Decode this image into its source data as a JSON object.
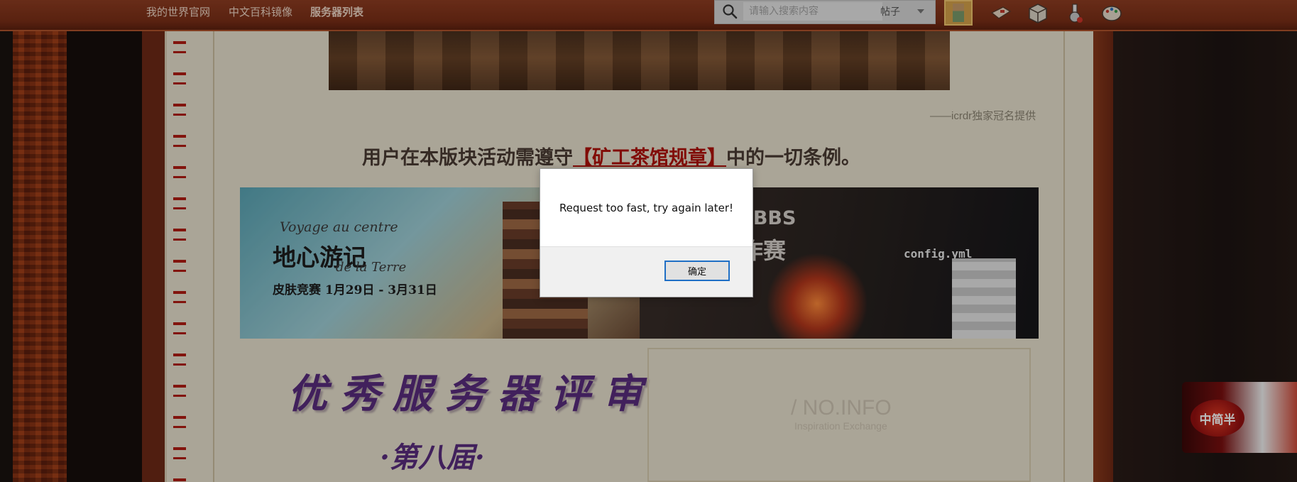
{
  "nav": {
    "links": [
      {
        "label": "我的世界官网"
      },
      {
        "label": "中文百科镜像"
      },
      {
        "label": "服务器列表"
      }
    ],
    "search_placeholder": "请输入搜索内容",
    "search_type": "帖子"
  },
  "page": {
    "credit": "——icrdr独家冠名提供",
    "rules_prefix": "用户在本版块活动需遵守",
    "rules_link": "【矿工茶馆规章】",
    "rules_suffix": "中的一切条例。",
    "banner_left": {
      "cursive_top": "Voyage au centre",
      "title": "地心游记",
      "cursive_bottom": "de la Terre",
      "subtitle": "皮肤竞赛  1月29日 - 3月31日"
    },
    "banner_right": {
      "title_top": "CBBS",
      "title_bottom": "创作赛",
      "config_label": "config.yml"
    },
    "review_title": "优秀服务器评审",
    "review_sub": "·第八届·",
    "info_brand": "/ NO.INFO",
    "info_tagline": "Inspiration Exchange",
    "mascot_label": "中简半"
  },
  "dialog": {
    "message": "Request too fast, try again later!",
    "ok_label": "确定"
  },
  "colors": {
    "topbar": "#7b2f17",
    "parchment": "#e9e2cf",
    "link_red": "#b1110a",
    "review_purple": "#5a2d7e",
    "dialog_focus": "#1f6fc5"
  }
}
